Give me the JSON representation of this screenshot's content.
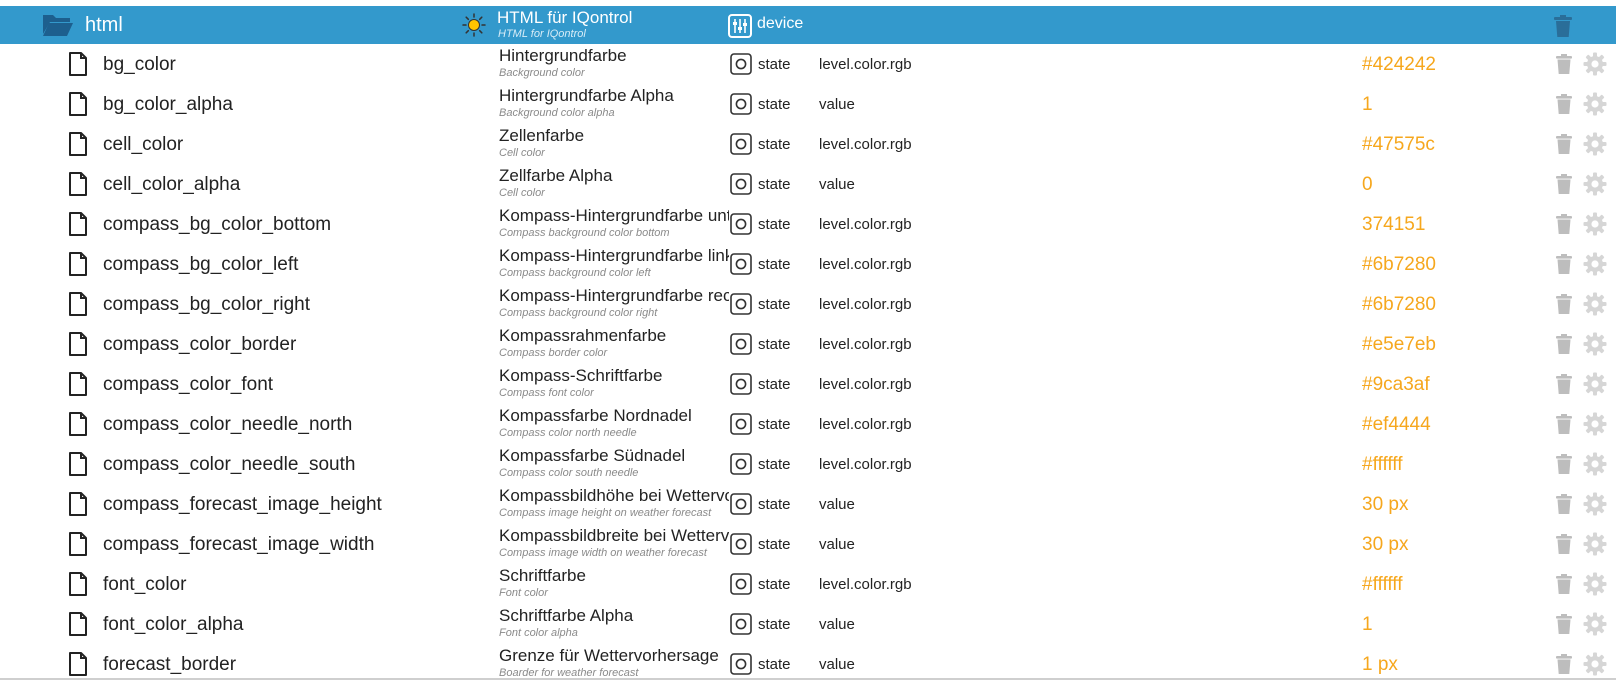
{
  "folder": {
    "name": "html",
    "title": "HTML für IQontrol",
    "subtitle": "HTML for IQontrol",
    "type": "device",
    "icons": {
      "folder": "folder-open-icon",
      "role": "sun-icon",
      "type": "device-sliders-icon",
      "delete": "trash-icon"
    },
    "colors": {
      "header_bg": "#3399cc"
    }
  },
  "rows": [
    {
      "name": "bg_color",
      "desc": "Hintergrundfarbe",
      "desc_en": "Background color",
      "type": "state",
      "role": "level.color.rgb",
      "value": "#424242"
    },
    {
      "name": "bg_color_alpha",
      "desc": "Hintergrundfarbe Alpha",
      "desc_en": "Background color alpha",
      "type": "state",
      "role": "value",
      "value": "1"
    },
    {
      "name": "cell_color",
      "desc": "Zellenfarbe",
      "desc_en": "Cell color",
      "type": "state",
      "role": "level.color.rgb",
      "value": "#47575c"
    },
    {
      "name": "cell_color_alpha",
      "desc": "Zellfarbe Alpha",
      "desc_en": "Cell color",
      "type": "state",
      "role": "value",
      "value": "0"
    },
    {
      "name": "compass_bg_color_bottom",
      "desc": "Kompass-Hintergrundfarbe unten",
      "desc_en": "Compass background color bottom",
      "type": "state",
      "role": "level.color.rgb",
      "value": "374151"
    },
    {
      "name": "compass_bg_color_left",
      "desc": "Kompass-Hintergrundfarbe links",
      "desc_en": "Compass background color left",
      "type": "state",
      "role": "level.color.rgb",
      "value": "#6b7280"
    },
    {
      "name": "compass_bg_color_right",
      "desc": "Kompass-Hintergrundfarbe rechts",
      "desc_en": "Compass background color right",
      "type": "state",
      "role": "level.color.rgb",
      "value": "#6b7280"
    },
    {
      "name": "compass_color_border",
      "desc": "Kompassrahmenfarbe",
      "desc_en": "Compass border color",
      "type": "state",
      "role": "level.color.rgb",
      "value": "#e5e7eb"
    },
    {
      "name": "compass_color_font",
      "desc": "Kompass-Schriftfarbe",
      "desc_en": "Compass font color",
      "type": "state",
      "role": "level.color.rgb",
      "value": "#9ca3af"
    },
    {
      "name": "compass_color_needle_north",
      "desc": "Kompassfarbe Nordnadel",
      "desc_en": "Compass color north needle",
      "type": "state",
      "role": "level.color.rgb",
      "value": "#ef4444"
    },
    {
      "name": "compass_color_needle_south",
      "desc": "Kompassfarbe Südnadel",
      "desc_en": "Compass color south needle",
      "type": "state",
      "role": "level.color.rgb",
      "value": "#ffffff"
    },
    {
      "name": "compass_forecast_image_height",
      "desc": "Kompassbildhöhe bei Wettervorhersage",
      "desc_en": "Compass image height on weather forecast",
      "type": "state",
      "role": "value",
      "value": "30 px"
    },
    {
      "name": "compass_forecast_image_width",
      "desc": "Kompassbildbreite bei Wettervorhersage",
      "desc_en": "Compass image width on weather forecast",
      "type": "state",
      "role": "value",
      "value": "30 px"
    },
    {
      "name": "font_color",
      "desc": "Schriftfarbe",
      "desc_en": "Font color",
      "type": "state",
      "role": "level.color.rgb",
      "value": "#ffffff"
    },
    {
      "name": "font_color_alpha",
      "desc": "Schriftfarbe Alpha",
      "desc_en": "Font color alpha",
      "type": "state",
      "role": "value",
      "value": "1"
    },
    {
      "name": "forecast_border",
      "desc": "Grenze für Wettervorhersage",
      "desc_en": "Boarder for weather forecast",
      "type": "state",
      "role": "value",
      "value": "1 px"
    }
  ],
  "row_icons": {
    "file": "file-icon",
    "state": "state-icon",
    "delete": "trash-icon",
    "settings": "gear-icon"
  },
  "colors": {
    "value": "#f6a71d",
    "icon_gray": "#bdbdbd"
  }
}
